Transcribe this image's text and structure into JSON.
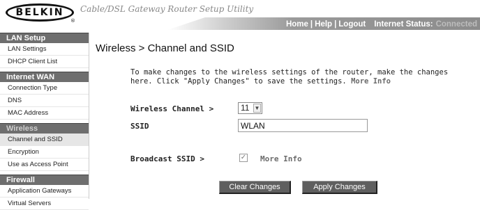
{
  "header": {
    "logo_text": "BELKIN",
    "registered_mark": "®",
    "subtitle": "Cable/DSL Gateway Router Setup Utility",
    "nav": {
      "home": "Home",
      "help": "Help",
      "logout": "Logout",
      "separator": "|"
    },
    "status_label": "Internet Status:",
    "status_value": "Connected"
  },
  "sidebar": {
    "sections": [
      {
        "title": "LAN Setup",
        "items": [
          "LAN Settings",
          "DHCP Client List"
        ]
      },
      {
        "title": "Internet WAN",
        "items": [
          "Connection Type",
          "DNS",
          "MAC Address"
        ]
      },
      {
        "title": "Wireless",
        "items": [
          "Channel and SSID",
          "Encryption",
          "Use as Access Point"
        ]
      },
      {
        "title": "Firewall",
        "items": [
          "Application Gateways",
          "Virtual Servers"
        ]
      }
    ]
  },
  "main": {
    "title": "Wireless > Channel and SSID",
    "description": "To make changes to the wireless settings of the router, make the changes here. Click \"Apply Changes\" to save the settings.",
    "more_info": "More Info",
    "channel_label": "Wireless Channel >",
    "channel_value": "11",
    "ssid_label": "SSID",
    "ssid_value": "WLAN",
    "broadcast_label": "Broadcast SSID >",
    "broadcast_checked": true,
    "broadcast_more_info": "More Info",
    "clear_button": "Clear Changes",
    "apply_button": "Apply Changes"
  }
}
